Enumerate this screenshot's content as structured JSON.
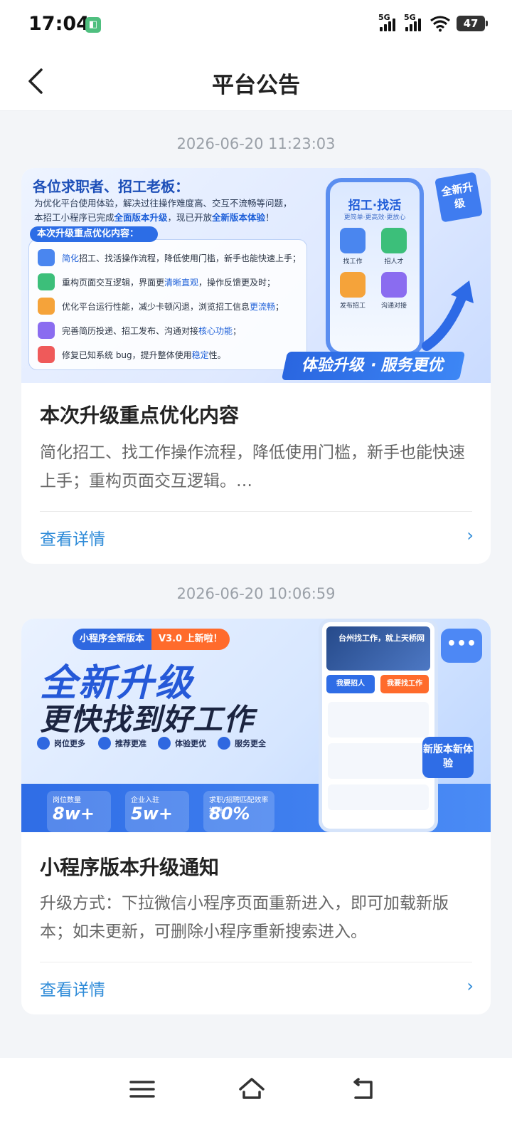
{
  "status_bar": {
    "time": "17:04",
    "signal_1": "5G",
    "signal_2": "5G",
    "battery": "47"
  },
  "header": {
    "title": "平台公告"
  },
  "announcements": [
    {
      "timestamp": "2026-06-20 11:23:03",
      "banner": {
        "greeting": "各位求职者、招工老板：",
        "intro_1": "为优化平台使用体验，解决过往操作难度高、交互不流畅等问题，",
        "intro_2a": "本招工小程序已完成",
        "intro_2b": "全面版本升级",
        "intro_2c": "，现已开放",
        "intro_2d": "全新版本体验",
        "intro_2e": "！",
        "list_title": "本次升级重点优化内容：",
        "items": [
          {
            "pre": "",
            "hl": "简化",
            "post": "招工、找活操作流程，降低使用门槛，新手也能快速上手；"
          },
          {
            "pre": "重构页面交互逻辑，界面更",
            "hl": "清晰直观",
            "post": "，操作反馈更及时；"
          },
          {
            "pre": "优化平台运行性能，减少卡顿闪退，浏览招工信息",
            "hl": "更流畅",
            "post": "；"
          },
          {
            "pre": "完善简历投递、招工发布、沟通对接",
            "hl": "核心功能",
            "post": "；"
          },
          {
            "pre": "修复已知系统 bug，提升整体使用",
            "hl": "稳定",
            "post": "性。"
          }
        ],
        "phone_title": "招工·找活",
        "phone_subtitle": "更简单·更高效·更放心",
        "phone_icons": [
          "找工作",
          "招人才",
          "发布招工",
          "沟通对接"
        ],
        "flag": "全新升级",
        "ribbon": "体验升级 · 服务更优"
      },
      "title": "本次升级重点优化内容",
      "desc": "简化招工、找工作操作流程，降低使用门槛，新手也能快速上手；重构页面交互逻辑。…",
      "link": "查看详情",
      "chevron": "›"
    },
    {
      "timestamp": "2026-06-20 10:06:59",
      "banner": {
        "tag_a": "小程序全新版本",
        "tag_b": "V3.0 上新啦！",
        "headline_1": "全新升级",
        "headline_2": "更快找到好工作",
        "features": [
          "岗位更多",
          "推荐更准",
          "体验更优",
          "服务更全"
        ],
        "stats": [
          {
            "label": "岗位数量",
            "value": "8w+"
          },
          {
            "label": "企业入驻",
            "value": "5w+"
          },
          {
            "label": "求职/招聘匹配效率提升",
            "value": "80%"
          }
        ],
        "phone_hero": "台州找工作，就上天桥网",
        "phone_btn_1": "我要招人",
        "phone_btn_2": "我要找工作",
        "badge": "新版本新体验",
        "chat": "•••"
      },
      "title": "小程序版本升级通知",
      "desc": "升级方式：下拉微信小程序页面重新进入，即可加载新版本；如未更新，可删除小程序重新搜索进入。",
      "link": "查看详情",
      "chevron": "›"
    }
  ],
  "nav_buttons": [
    "menu-icon",
    "home-icon",
    "back-return-icon"
  ]
}
